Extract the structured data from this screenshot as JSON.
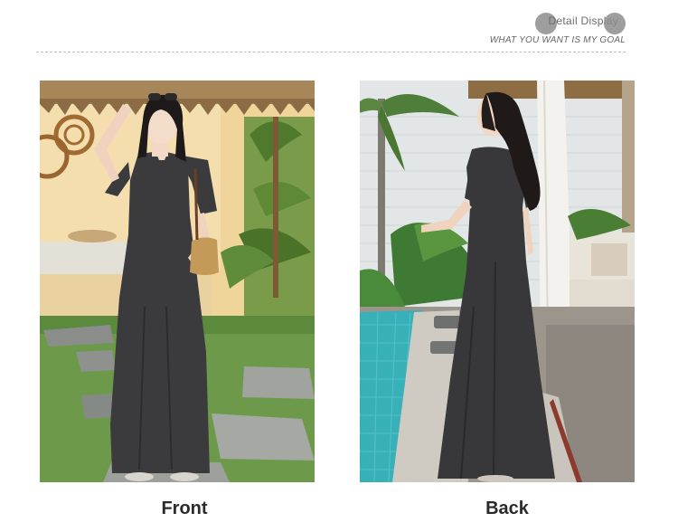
{
  "header": {
    "title": "Detail Display",
    "slogan": "WHAT YOU WANT IS MY GOAL"
  },
  "photos": [
    {
      "label": "Front",
      "icon": "front-model-photo"
    },
    {
      "label": "Back",
      "icon": "back-model-photo"
    }
  ],
  "colors": {
    "dress": "#3a3a3c",
    "wall": "#f1d9a3",
    "grass": "#6e9a4c",
    "pool": "#2fa7b0",
    "thatch": "#a7865a"
  }
}
